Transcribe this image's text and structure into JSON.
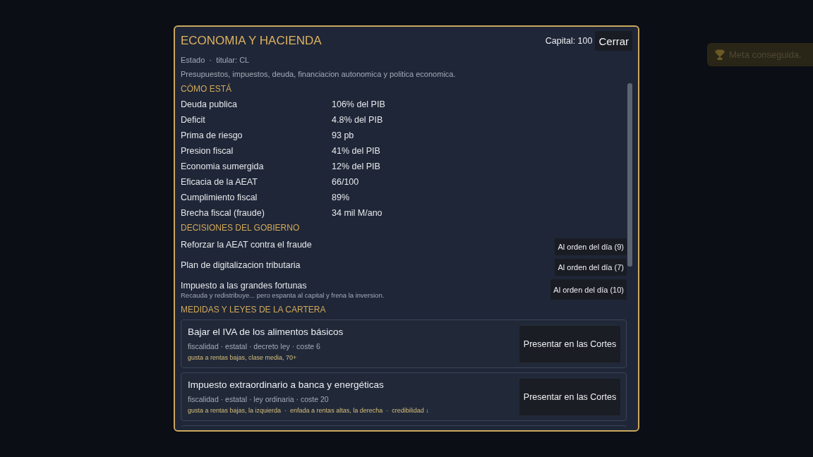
{
  "panel": {
    "title": "ECONOMIA Y HACIENDA",
    "capital": "Capital: 100",
    "close_button": "Cerrar",
    "subtitle": "Estado  ·  titular: CL",
    "description": "Presupuestos, impuestos, deuda, financiacion autonomica y politica economica."
  },
  "status_section": {
    "heading": "CÓMO ESTÁ",
    "rows": [
      {
        "label": "Deuda publica",
        "value": "106% del PIB"
      },
      {
        "label": "Deficit",
        "value": "4.8% del PIB"
      },
      {
        "label": "Prima de riesgo",
        "value": "93 pb"
      },
      {
        "label": "Presion fiscal",
        "value": "41% del PIB"
      },
      {
        "label": "Economia sumergida",
        "value": "12% del PIB"
      },
      {
        "label": "Eficacia de la AEAT",
        "value": "66/100"
      },
      {
        "label": "Cumplimiento fiscal",
        "value": "89%"
      },
      {
        "label": "Brecha fiscal (fraude)",
        "value": "34 mil M/ano"
      }
    ]
  },
  "decisions_section": {
    "heading": "DECISIONES DEL GOBIERNO",
    "items": [
      {
        "title": "Reforzar la AEAT contra el fraude",
        "button": "Al orden del día (9)"
      },
      {
        "title": "Plan de digitalizacion tributaria",
        "button": "Al orden del día (7)"
      },
      {
        "title": "Impuesto a las grandes fortunas",
        "note": "Recauda y redistribuye... pero espanta al capital y frena la inversion.",
        "button": "Al orden del día (10)"
      }
    ]
  },
  "measures_section": {
    "heading": "MEDIDAS Y LEYES DE LA CARTERA",
    "items": [
      {
        "title": "Bajar el IVA de los alimentos básicos",
        "meta": "fiscalidad · estatal · decreto ley · coste 6",
        "tags": "gusta a rentas bajas, clase media, 70+",
        "button": "Presentar en las Cortes"
      },
      {
        "title": "Impuesto extraordinario a banca y energéticas",
        "meta": "fiscalidad · estatal · ley ordinaria · coste 20",
        "tags": "gusta a rentas bajas, la izquierda  ·  enfada a rentas altas, la derecha  ·  credibilidad ↓",
        "button": "Presentar en las Cortes"
      }
    ]
  },
  "toast": {
    "text": "Meta conseguida."
  }
}
